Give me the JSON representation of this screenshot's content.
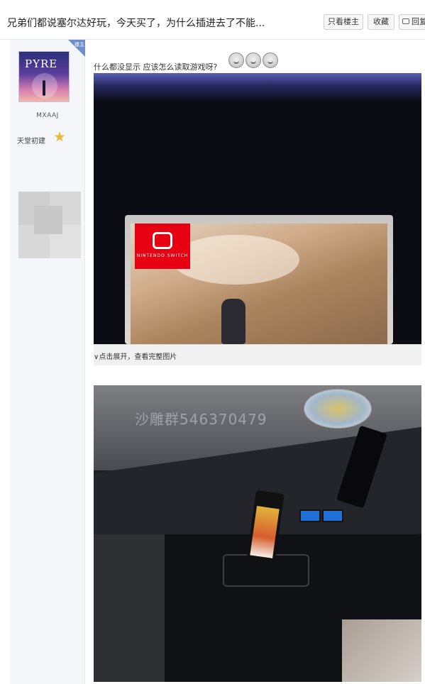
{
  "header": {
    "title": "兄弟们都说塞尔达好玩，今天买了，为什么插进去了不能...",
    "only_op_label": "只看楼主",
    "favorite_label": "收藏",
    "reply_label": "回复"
  },
  "author": {
    "badge": "楼主",
    "avatar_text": "PYRE",
    "username": "MXAAJ",
    "level_title": "天堂初建"
  },
  "post": {
    "question": "什么都没显示 应该怎么读取游戏呀?",
    "image1_brand": "NINTENDO SWITCH",
    "expand_text": "∨点击展开，查看完整图片",
    "watermark": "沙雕群546370479"
  }
}
